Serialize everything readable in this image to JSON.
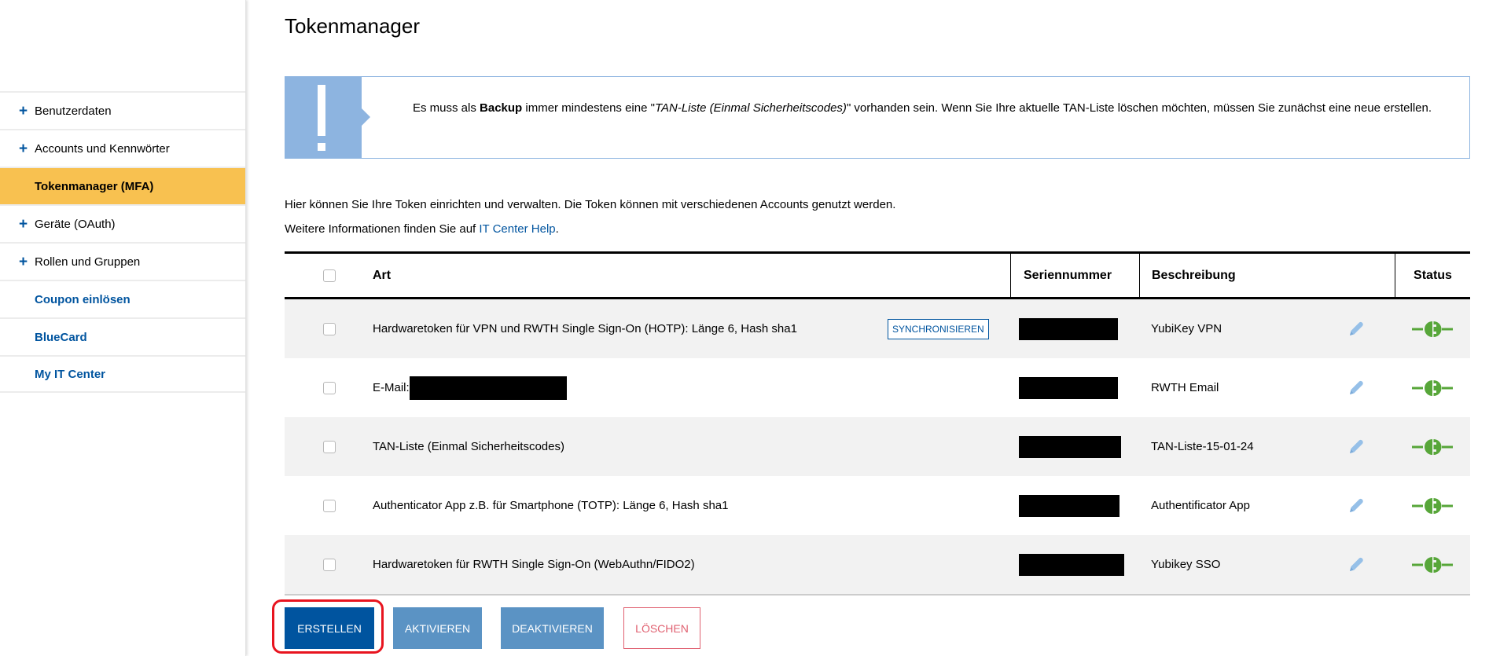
{
  "sidebar": {
    "items": [
      {
        "label": "Benutzerdaten",
        "expandable": true
      },
      {
        "label": "Accounts und Kennwörter",
        "expandable": true
      },
      {
        "label": "Tokenmanager (MFA)",
        "active": true
      },
      {
        "label": "Geräte (OAuth)",
        "expandable": true
      },
      {
        "label": "Rollen und Gruppen",
        "expandable": true
      },
      {
        "label": "Coupon einlösen",
        "link": true
      },
      {
        "label": "BlueCard",
        "link": true
      },
      {
        "label": "My IT Center",
        "link": true
      }
    ],
    "plus_glyph": "+"
  },
  "page": {
    "title": "Tokenmanager"
  },
  "notice": {
    "text_1": "Es muss als ",
    "text_bold": "Backup",
    "text_2": " immer mindestens eine \"",
    "text_italic": "TAN-Liste (Einmal Sicherheitscodes)",
    "text_3": "\" vorhanden sein. Wenn Sie Ihre aktuelle TAN-Liste löschen möchten, müssen Sie zunächst eine neue erstellen.",
    "color": "#8db4e0"
  },
  "intro": {
    "line1": "Hier können Sie Ihre Token einrichten und verwalten. Die Token können mit verschiedenen Accounts genutzt werden.",
    "line2_prefix": "Weitere Informationen finden Sie auf ",
    "link_text": "IT Center Help",
    "line2_suffix": "."
  },
  "table": {
    "headers": {
      "art": "Art",
      "serial": "Seriennummer",
      "description": "Beschreibung",
      "status": "Status"
    },
    "rows": [
      {
        "art": "Hardwaretoken für VPN und RWTH Single Sign-On (HOTP): Länge 6, Hash sha1",
        "action": "SYNCHRONISIEREN",
        "serial": "[redacted]",
        "description": "YubiKey VPN",
        "status": "active"
      },
      {
        "art": "E-Mail:",
        "art_redacted": true,
        "serial": "[redacted]",
        "description": "RWTH Email",
        "status": "active"
      },
      {
        "art": "TAN-Liste (Einmal Sicherheitscodes)",
        "serial": "[redacted]",
        "description": "TAN-Liste-15-01-24",
        "status": "active"
      },
      {
        "art": "Authenticator App z.B. für Smartphone (TOTP): Länge 6, Hash sha1",
        "serial": "[redacted]",
        "description": "Authentificator App",
        "status": "active"
      },
      {
        "art": "Hardwaretoken für RWTH Single Sign-On (WebAuthn/FIDO2)",
        "serial": "[redacted]",
        "description": "Yubikey SSO",
        "status": "active"
      }
    ]
  },
  "buttons": {
    "create": "ERSTELLEN",
    "activate": "AKTIVIEREN",
    "deactivate": "DEAKTIVIEREN",
    "delete": "LÖSCHEN"
  },
  "colors": {
    "brand_blue": "#00549f",
    "active_nav": "#f8c150",
    "status_green": "#57a639",
    "highlight_red": "#e8141f"
  }
}
